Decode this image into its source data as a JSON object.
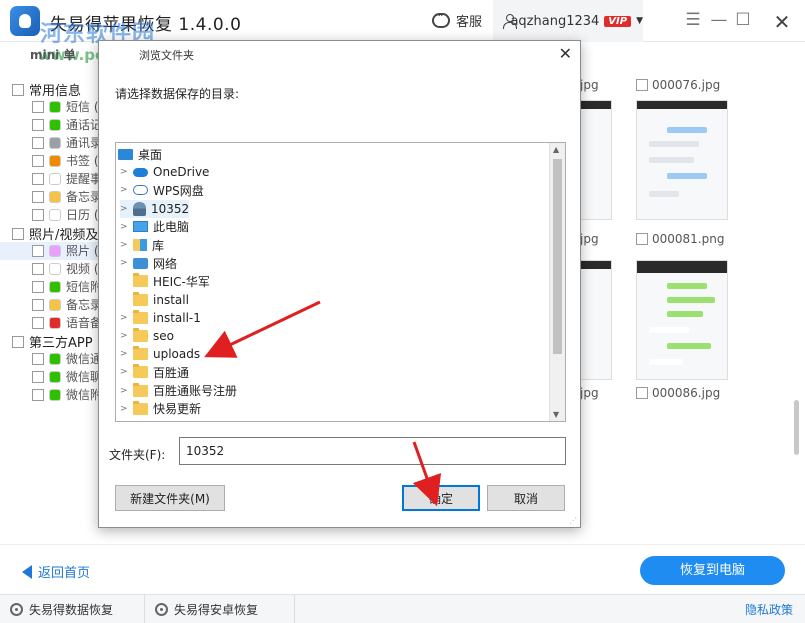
{
  "window": {
    "title": "失易得苹果恢复 1.4.0.0",
    "customer_service": "客服",
    "username": "aqzhang1234",
    "vip_badge": "VIP"
  },
  "watermark": {
    "text": "河东软件园",
    "url": "www.pc0359.cn"
  },
  "toolbar_partial": "mini 单",
  "left_tree": {
    "categories": [
      {
        "label": "常用信息",
        "items": [
          {
            "label": "短信 (6",
            "color": "#2dc100"
          },
          {
            "label": "通话记",
            "color": "#2dc100"
          },
          {
            "label": "通讯录",
            "color": "#9aa0a6"
          },
          {
            "label": "书签 (6",
            "color": "#f08a00"
          },
          {
            "label": "提醒事",
            "color": "#ffffff"
          },
          {
            "label": "备忘录",
            "color": "#f6c344"
          },
          {
            "label": "日历 (1",
            "color": "#ffffff"
          }
        ]
      },
      {
        "label": "照片/视频及",
        "items": [
          {
            "label": "照片 (3",
            "color": "#e8a0ff"
          },
          {
            "label": "视频 (2",
            "color": "#ffffff"
          },
          {
            "label": "短信附",
            "color": "#2dc100"
          },
          {
            "label": "备忘录",
            "color": "#f6c344"
          },
          {
            "label": "语音备",
            "color": "#e02b2b"
          }
        ]
      },
      {
        "label": "第三方APP",
        "items": [
          {
            "label": "微信通",
            "color": "#2dc100"
          },
          {
            "label": "微信聊",
            "color": "#2dc100"
          },
          {
            "label": "微信附",
            "color": "#2dc100"
          }
        ]
      }
    ]
  },
  "thumbnails": [
    {
      "label": "jpg"
    },
    {
      "label": "000076.jpg"
    },
    {
      "label": "jpg"
    },
    {
      "label": "000081.png"
    },
    {
      "label": "jpg"
    },
    {
      "label": "000086.jpg"
    }
  ],
  "dialog": {
    "title": "浏览文件夹",
    "close": "✕",
    "prompt": "请选择数据保存的目录:",
    "tree": [
      {
        "label": "桌面",
        "icon": "desktop-icon",
        "expand": "",
        "level": 0
      },
      {
        "label": "OneDrive",
        "icon": "cloud-icon",
        "expand": ">",
        "level": 1
      },
      {
        "label": "WPS网盘",
        "icon": "wps-icon",
        "expand": ">",
        "level": 1
      },
      {
        "label": "10352",
        "icon": "person-icon",
        "expand": ">",
        "level": 1,
        "selected": true
      },
      {
        "label": "此电脑",
        "icon": "pc-icon",
        "expand": ">",
        "level": 1
      },
      {
        "label": "库",
        "icon": "library-icon",
        "expand": ">",
        "level": 1
      },
      {
        "label": "网络",
        "icon": "network-icon",
        "expand": ">",
        "level": 1
      },
      {
        "label": "HEIC-华军",
        "icon": "folder-icon",
        "expand": "",
        "level": 1
      },
      {
        "label": "install",
        "icon": "folder-icon",
        "expand": "",
        "level": 1
      },
      {
        "label": "install-1",
        "icon": "folder-icon",
        "expand": ">",
        "level": 1
      },
      {
        "label": "seo",
        "icon": "folder-icon",
        "expand": ">",
        "level": 1
      },
      {
        "label": "uploads",
        "icon": "folder-icon",
        "expand": ">",
        "level": 1
      },
      {
        "label": "百胜通",
        "icon": "folder-icon",
        "expand": ">",
        "level": 1
      },
      {
        "label": "百胜通账号注册",
        "icon": "folder-icon",
        "expand": ">",
        "level": 1
      },
      {
        "label": "快易更新",
        "icon": "folder-icon",
        "expand": ">",
        "level": 1
      }
    ],
    "folder_label": "文件夹(F):",
    "folder_value": "10352",
    "new_folder_button": "新建文件夹(M)",
    "ok_button": "确定",
    "cancel_button": "取消"
  },
  "footer": {
    "back_home": "返回首页",
    "recover_button": "恢复到电脑",
    "tabs": [
      "失易得数据恢复",
      "失易得安卓恢复"
    ],
    "privacy": "隐私政策"
  },
  "colors": {
    "accent": "#1e8cf0",
    "link": "#1e78d7",
    "annotation_arrow": "#e02020"
  }
}
